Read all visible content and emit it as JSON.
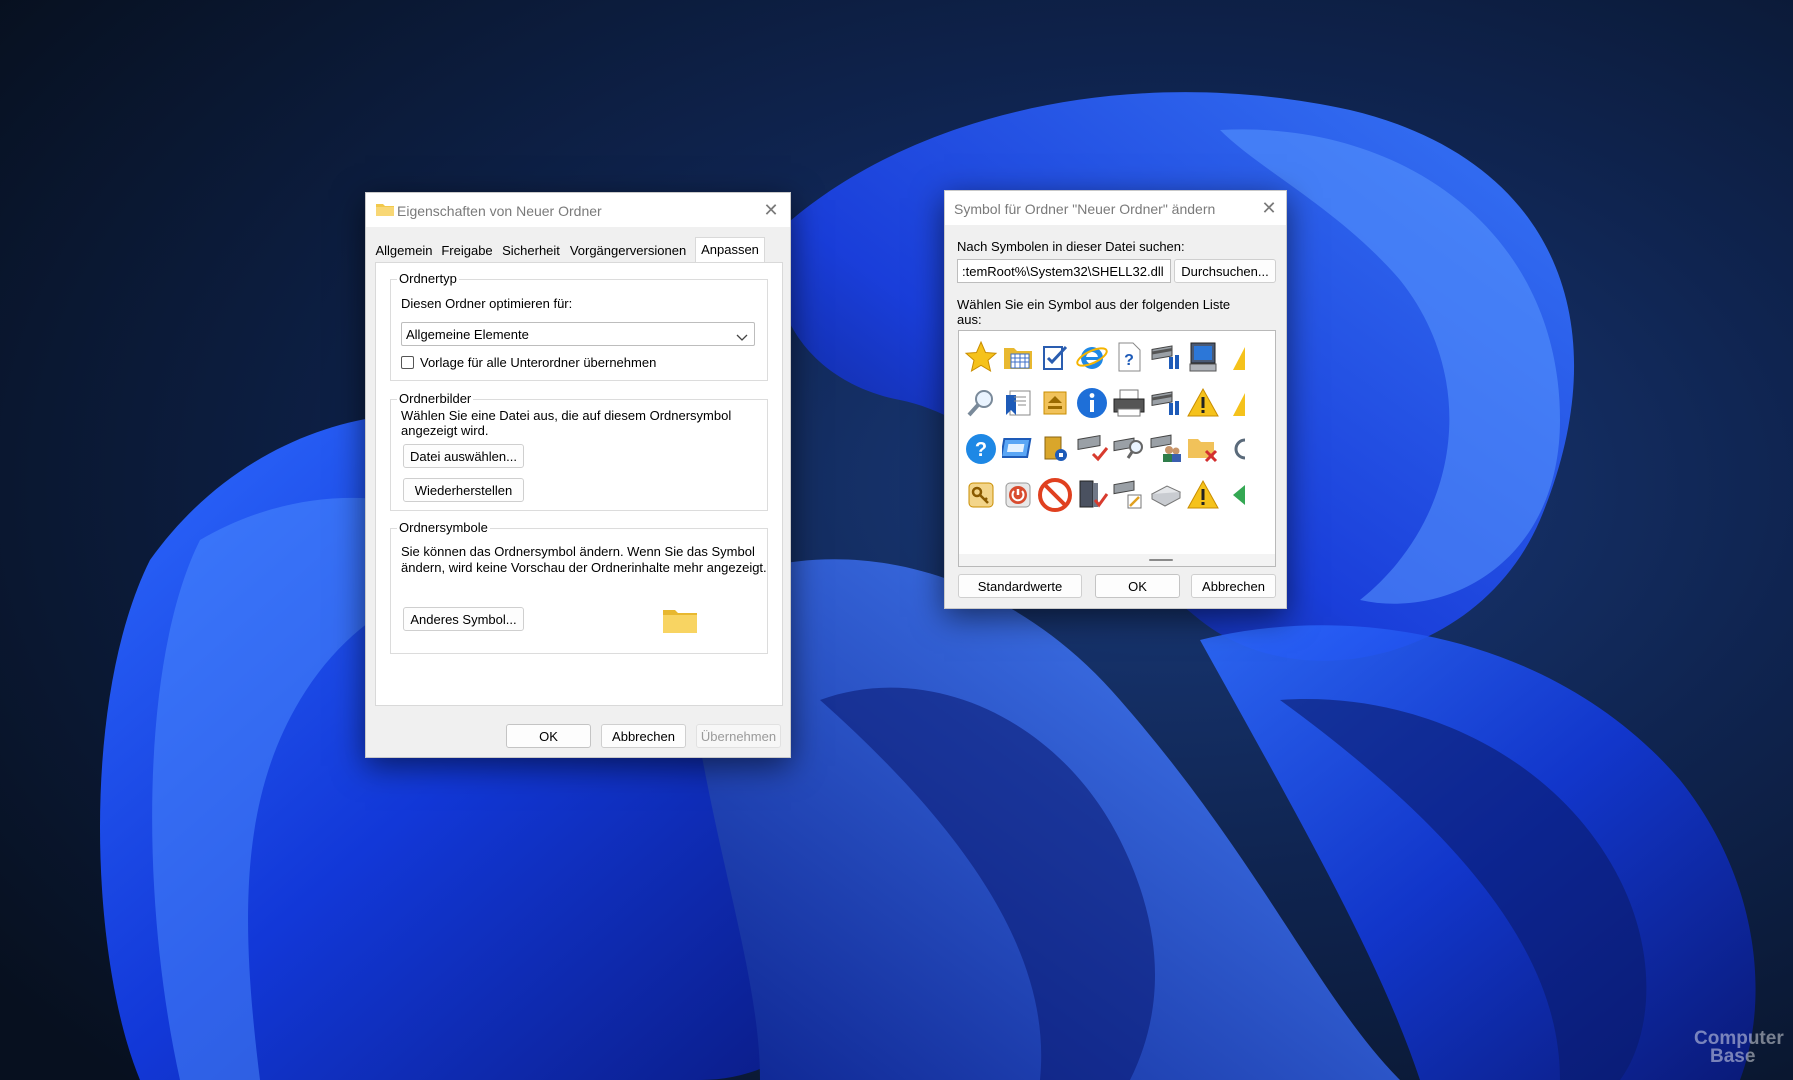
{
  "props_dialog": {
    "title": "Eigenschaften von Neuer Ordner",
    "tabs": [
      {
        "label": "Allgemein"
      },
      {
        "label": "Freigabe"
      },
      {
        "label": "Sicherheit"
      },
      {
        "label": "Vorgängerversionen"
      },
      {
        "label": "Anpassen"
      }
    ],
    "ordnertyp": {
      "legend": "Ordnertyp",
      "optimize_label": "Diesen Ordner optimieren für:",
      "select_value": "Allgemeine Elemente",
      "checkbox_label": "Vorlage für alle Unterordner übernehmen",
      "checkbox_checked": false
    },
    "ordnerbilder": {
      "legend": "Ordnerbilder",
      "description_line1": "Wählen Sie eine Datei aus, die auf diesem Ordnersymbol",
      "description_line2": "angezeigt wird.",
      "choose_file_button": "Datei auswählen...",
      "restore_button": "Wiederherstellen"
    },
    "ordnersymbole": {
      "legend": "Ordnersymbole",
      "description_line1": "Sie können das Ordnersymbol ändern. Wenn Sie das Symbol",
      "description_line2": "ändern, wird keine Vorschau der Ordnerinhalte mehr angezeigt.",
      "change_icon_button": "Anderes Symbol..."
    },
    "buttons": {
      "ok": "OK",
      "cancel": "Abbrechen",
      "apply": "Übernehmen"
    }
  },
  "icon_dialog": {
    "title": "Symbol für Ordner \"Neuer Ordner\" ändern",
    "search_label": "Nach Symbolen in dieser Datei suchen:",
    "path_value": ":temRoot%\\System32\\SHELL32.dll",
    "browse_button": "Durchsuchen...",
    "list_label_line1": "Wählen Sie ein Symbol aus der folgenden Liste",
    "list_label_line2": "aus:",
    "icons": [
      [
        "star-icon",
        "folder-calendar-icon",
        "checklist-icon",
        "internet-explorer-icon",
        "help-page-icon",
        "network-computers-icon",
        "monitor-icon",
        "warning-icon-partial"
      ],
      [
        "magnifier-icon",
        "bookmark-page-icon",
        "eject-box-icon",
        "info-icon",
        "printer-icon",
        "network-computers-icon",
        "warning-icon",
        "warning-icon-partial"
      ],
      [
        "help-circle-icon",
        "window-frame-icon",
        "tag-file-icon",
        "network-ok-icon",
        "network-search-icon",
        "network-users-icon",
        "folder-delete-icon",
        "refresh-icon-partial"
      ],
      [
        "key-icon",
        "power-button-icon",
        "no-entry-icon",
        "server-check-icon",
        "network-edit-icon",
        "printer-outline-icon",
        "warning-icon",
        "green-arrow-icon-partial"
      ]
    ],
    "buttons": {
      "defaults": "Standardwerte",
      "ok": "OK",
      "cancel": "Abbrechen"
    }
  },
  "watermark": {
    "text_line1": "Computer",
    "text_line2": "Base"
  },
  "colors": {
    "accent": "#1e50ff",
    "wallpaper_dark": "#0b1630",
    "dialog_bg": "#f0f0f0"
  }
}
